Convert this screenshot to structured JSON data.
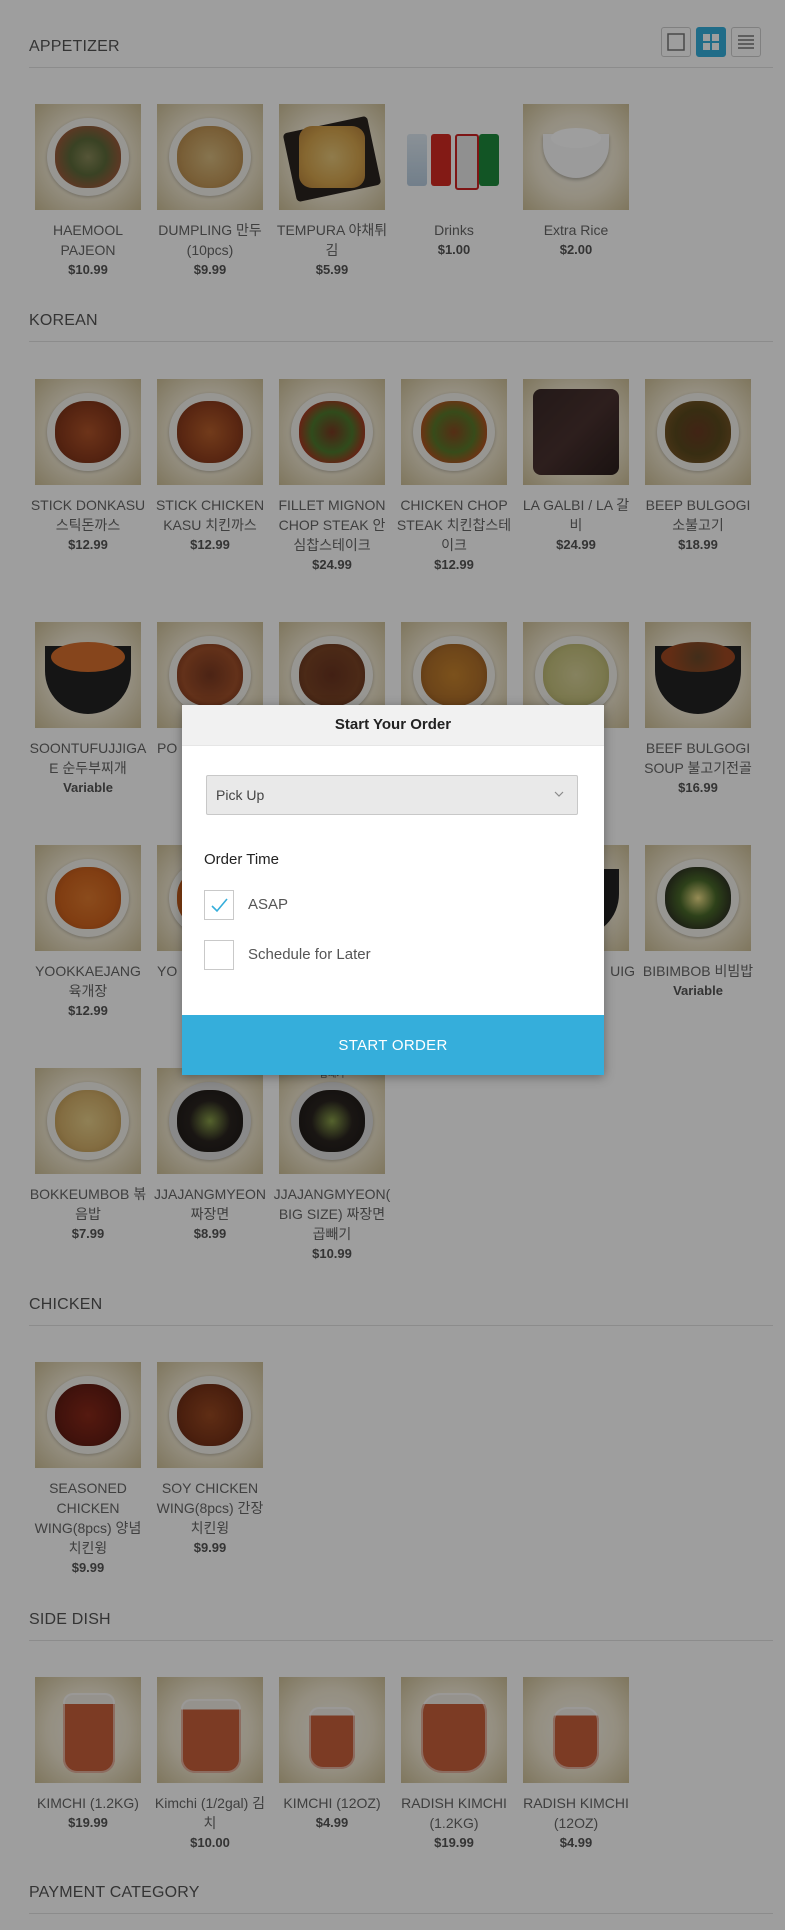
{
  "sections": {
    "appetizer": "APPETIZER",
    "korean": "KOREAN",
    "chicken": "CHICKEN",
    "side_dish": "SIDE DISH",
    "payment": "PAYMENT CATEGORY"
  },
  "view_icons": [
    "single-view-icon",
    "grid-view-icon",
    "list-view-icon"
  ],
  "items": {
    "haemool": {
      "name": "HAEMOOL PAJEON",
      "price": "$10.99"
    },
    "dumpling": {
      "name": "DUMPLING 만두 (10pcs)",
      "price": "$9.99"
    },
    "tempura": {
      "name": "TEMPURA 야채튀김",
      "price": "$5.99"
    },
    "drinks": {
      "name": "Drinks",
      "price": "$1.00"
    },
    "rice": {
      "name": "Extra Rice",
      "price": "$2.00"
    },
    "donkasu": {
      "name": "STICK DONKASU 스틱돈까스",
      "price": "$12.99"
    },
    "chicken_kasu": {
      "name": "STICK CHICKEN KASU 치킨까스",
      "price": "$12.99"
    },
    "fillet": {
      "name": "FILLET MIGNON CHOP STEAK 안심찹스테이크",
      "price": "$24.99"
    },
    "chicken_chop": {
      "name": "CHICKEN CHOP STEAK 치킨찹스테이크",
      "price": "$12.99"
    },
    "galbi": {
      "name": "LA GALBI / LA 갈비",
      "price": "$24.99"
    },
    "bulgogi": {
      "name": "BEEP BULGOGI 소불고기",
      "price": "$18.99"
    },
    "soontufu": {
      "name": "SOONTUFUJJIGAE 순두부찌개",
      "price": "Variable"
    },
    "beef_soup": {
      "name": "BEEF BULGOGI SOUP 불고기전골",
      "price": "$16.99"
    },
    "yookkae": {
      "name": "YOOKKAEJANG 육개장",
      "price": "$12.99"
    },
    "bibimbob": {
      "name": "BIBIMBOB 비빔밥",
      "price": "Variable"
    },
    "bokkeum": {
      "name": "BOKKEUMBOB 볶음밥",
      "price": "$7.99"
    },
    "jjajang": {
      "name": "JJAJANGMYEON 짜장면",
      "price": "$8.99"
    },
    "jjajang_big": {
      "name": "JJAJANGMYEON(BIG SIZE) 짜장면 곱빼기",
      "price": "$10.99"
    },
    "seasoned_wing": {
      "name": "SEASONED CHICKEN WING(8pcs) 양념 치킨윙",
      "price": "$9.99"
    },
    "soy_wing": {
      "name": "SOY CHICKEN WING(8pcs) 간장 치킨윙",
      "price": "$9.99"
    },
    "kimchi_12": {
      "name": "KIMCHI (1.2KG)",
      "price": "$19.99"
    },
    "kimchi_half": {
      "name": "Kimchi (1/2gal) 김치",
      "price": "$10.00"
    },
    "kimchi_oz": {
      "name": "KIMCHI (12OZ)",
      "price": "$4.99"
    },
    "radish_12": {
      "name": "RADISH KIMCHI (1.2KG)",
      "price": "$19.99"
    },
    "radish_oz": {
      "name": "RADISH KIMCHI (12OZ)",
      "price": "$4.99"
    }
  },
  "partial": {
    "po": "PO",
    "yo": "YO",
    "uig": "UIG",
    "banner": "곱빼기"
  },
  "modal": {
    "title": "Start Your Order",
    "order_type": "Pick Up",
    "order_time_label": "Order Time",
    "asap": "ASAP",
    "schedule": "Schedule for Later",
    "start_button": "START ORDER",
    "asap_checked": true,
    "schedule_checked": false
  },
  "colors": {
    "accent": "#35aedb",
    "overlay": "rgba(0,0,0,0.38)"
  }
}
